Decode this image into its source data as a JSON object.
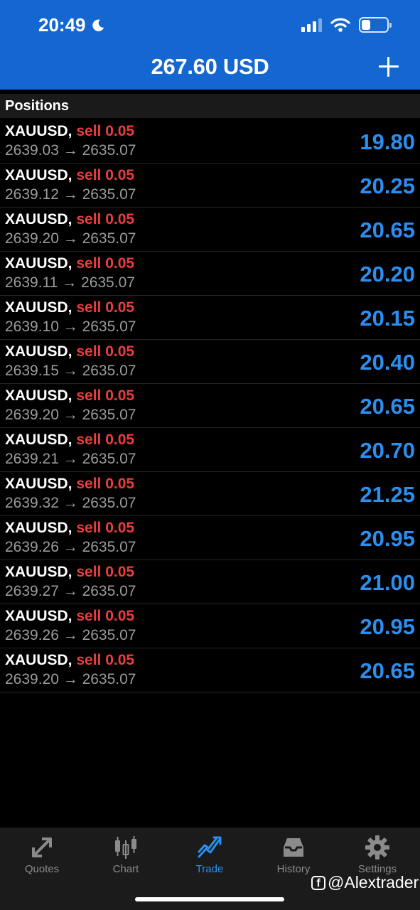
{
  "status_bar": {
    "time": "20:49"
  },
  "header": {
    "balance": "267.60 USD"
  },
  "section": {
    "title": "Positions"
  },
  "positions": [
    {
      "symbol": "XAUUSD,",
      "side": "sell 0.05",
      "prices": "2639.03 → 2635.07",
      "profit": "19.80"
    },
    {
      "symbol": "XAUUSD,",
      "side": "sell 0.05",
      "prices": "2639.12 → 2635.07",
      "profit": "20.25"
    },
    {
      "symbol": "XAUUSD,",
      "side": "sell 0.05",
      "prices": "2639.20 → 2635.07",
      "profit": "20.65"
    },
    {
      "symbol": "XAUUSD,",
      "side": "sell 0.05",
      "prices": "2639.11 → 2635.07",
      "profit": "20.20"
    },
    {
      "symbol": "XAUUSD,",
      "side": "sell 0.05",
      "prices": "2639.10 → 2635.07",
      "profit": "20.15"
    },
    {
      "symbol": "XAUUSD,",
      "side": "sell 0.05",
      "prices": "2639.15 → 2635.07",
      "profit": "20.40"
    },
    {
      "symbol": "XAUUSD,",
      "side": "sell 0.05",
      "prices": "2639.20 → 2635.07",
      "profit": "20.65"
    },
    {
      "symbol": "XAUUSD,",
      "side": "sell 0.05",
      "prices": "2639.21 → 2635.07",
      "profit": "20.70"
    },
    {
      "symbol": "XAUUSD,",
      "side": "sell 0.05",
      "prices": "2639.32 → 2635.07",
      "profit": "21.25"
    },
    {
      "symbol": "XAUUSD,",
      "side": "sell 0.05",
      "prices": "2639.26 → 2635.07",
      "profit": "20.95"
    },
    {
      "symbol": "XAUUSD,",
      "side": "sell 0.05",
      "prices": "2639.27 → 2635.07",
      "profit": "21.00"
    },
    {
      "symbol": "XAUUSD,",
      "side": "sell 0.05",
      "prices": "2639.26 → 2635.07",
      "profit": "20.95"
    },
    {
      "symbol": "XAUUSD,",
      "side": "sell 0.05",
      "prices": "2639.20 → 2635.07",
      "profit": "20.65"
    }
  ],
  "tabbar": {
    "items": [
      {
        "label": "Quotes",
        "icon": "quotes-icon"
      },
      {
        "label": "Chart",
        "icon": "chart-icon"
      },
      {
        "label": "Trade",
        "icon": "trade-icon"
      },
      {
        "label": "History",
        "icon": "history-icon"
      },
      {
        "label": "Settings",
        "icon": "settings-icon"
      }
    ],
    "active": "Trade"
  },
  "watermark": {
    "text": "@Alextrader"
  },
  "colors": {
    "header": "#1467d1",
    "sell": "#ec3d3d",
    "profit": "#2b8ff0",
    "tab_active": "#2b8ff0"
  }
}
